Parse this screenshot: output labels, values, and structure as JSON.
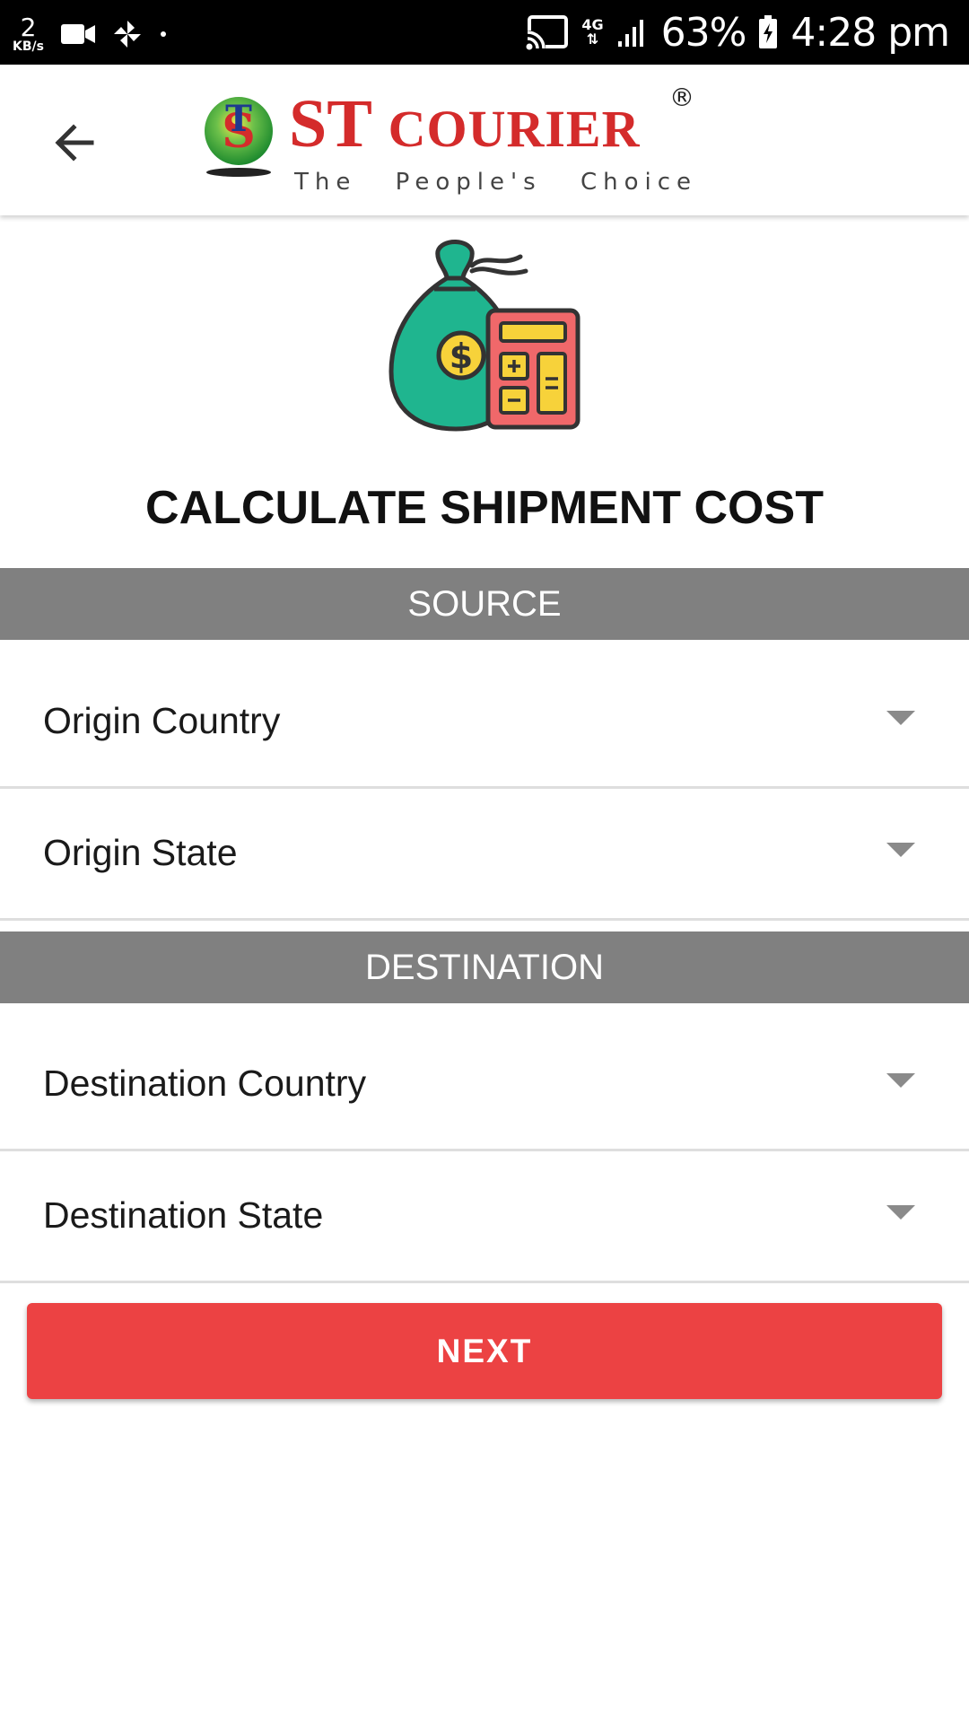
{
  "status_bar": {
    "speed_value": "2",
    "speed_unit": "KB/s",
    "network": "4G",
    "battery": "63%",
    "time": "4:28 pm"
  },
  "header": {
    "back_icon": "arrow-left-icon",
    "logo": {
      "title_big": "ST ",
      "title_small": "COURIER",
      "registered": "®",
      "tagline": "The People's Choice"
    }
  },
  "illustration": "money-bag-calculator-icon",
  "page": {
    "title": "CALCULATE SHIPMENT COST"
  },
  "source": {
    "heading": "SOURCE",
    "fields": [
      {
        "label": "Origin Country"
      },
      {
        "label": "Origin State"
      }
    ]
  },
  "destination": {
    "heading": "DESTINATION",
    "fields": [
      {
        "label": "Destination Country"
      },
      {
        "label": "Destination State"
      }
    ]
  },
  "actions": {
    "next_label": "NEXT"
  },
  "colors": {
    "accent": "#ec4243",
    "section_band": "#808080",
    "logo_red": "#d42b2b",
    "bag_green": "#1fb58f",
    "calculator": "#f0686a"
  }
}
